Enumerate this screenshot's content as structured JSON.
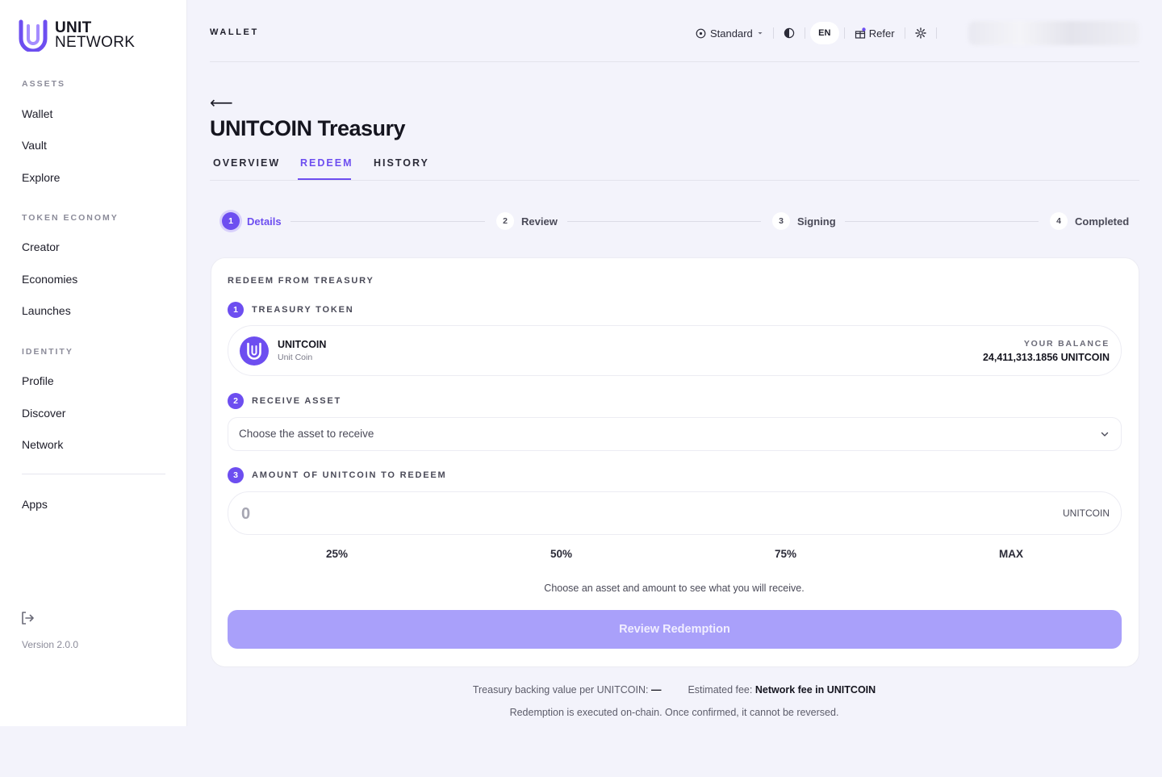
{
  "brand": {
    "line1": "UNIT",
    "line2": "NETWORK",
    "accent": "#6d4ef0"
  },
  "sidebar": {
    "sections": [
      {
        "title": "ASSETS",
        "items": [
          "Wallet",
          "Vault",
          "Explore"
        ]
      },
      {
        "title": "TOKEN ECONOMY",
        "items": [
          "Creator",
          "Economies",
          "Launches"
        ]
      },
      {
        "title": "IDENTITY",
        "items": [
          "Profile",
          "Discover",
          "Network"
        ]
      }
    ],
    "apps_label": "Apps",
    "logout_icon": "logout-icon",
    "version": "Version 2.0.0"
  },
  "header": {
    "title": "WALLET",
    "mode_label": "Standard",
    "lang": "EN",
    "refer_label": "Refer"
  },
  "page": {
    "title": "UNITCOIN Treasury",
    "tabs": [
      "OVERVIEW",
      "REDEEM",
      "HISTORY"
    ],
    "active_tab": "REDEEM"
  },
  "stepper": [
    {
      "num": "1",
      "label": "Details",
      "active": true
    },
    {
      "num": "2",
      "label": "Review",
      "active": false
    },
    {
      "num": "3",
      "label": "Signing",
      "active": false
    },
    {
      "num": "4",
      "label": "Completed",
      "active": false
    }
  ],
  "form": {
    "heading": "REDEEM FROM TREASURY",
    "field1": {
      "num": "1",
      "label": "TREASURY TOKEN"
    },
    "token": {
      "symbol": "UNITCOIN",
      "name": "Unit Coin"
    },
    "balance_label": "YOUR BALANCE",
    "balance_value": "24,411,313.1856 UNITCOIN",
    "field2": {
      "num": "2",
      "label": "RECEIVE ASSET"
    },
    "select_placeholder": "Choose the asset to receive",
    "field3": {
      "num": "3",
      "label": "AMOUNT OF UNITCOIN TO REDEEM"
    },
    "amount_placeholder": "0",
    "amount_unit": "UNITCOIN",
    "percent_buttons": [
      "25%",
      "50%",
      "75%",
      "MAX"
    ],
    "hint": "Choose an asset and amount to see what you will receive.",
    "cta": "Review Redemption"
  },
  "footer": {
    "backing_label": "Treasury backing value per UNITCOIN:",
    "backing_value": "—",
    "fee_label": "Estimated fee:",
    "fee_value": "Network fee in UNITCOIN",
    "note": "Redemption is executed on-chain. Once confirmed, it cannot be reversed."
  }
}
